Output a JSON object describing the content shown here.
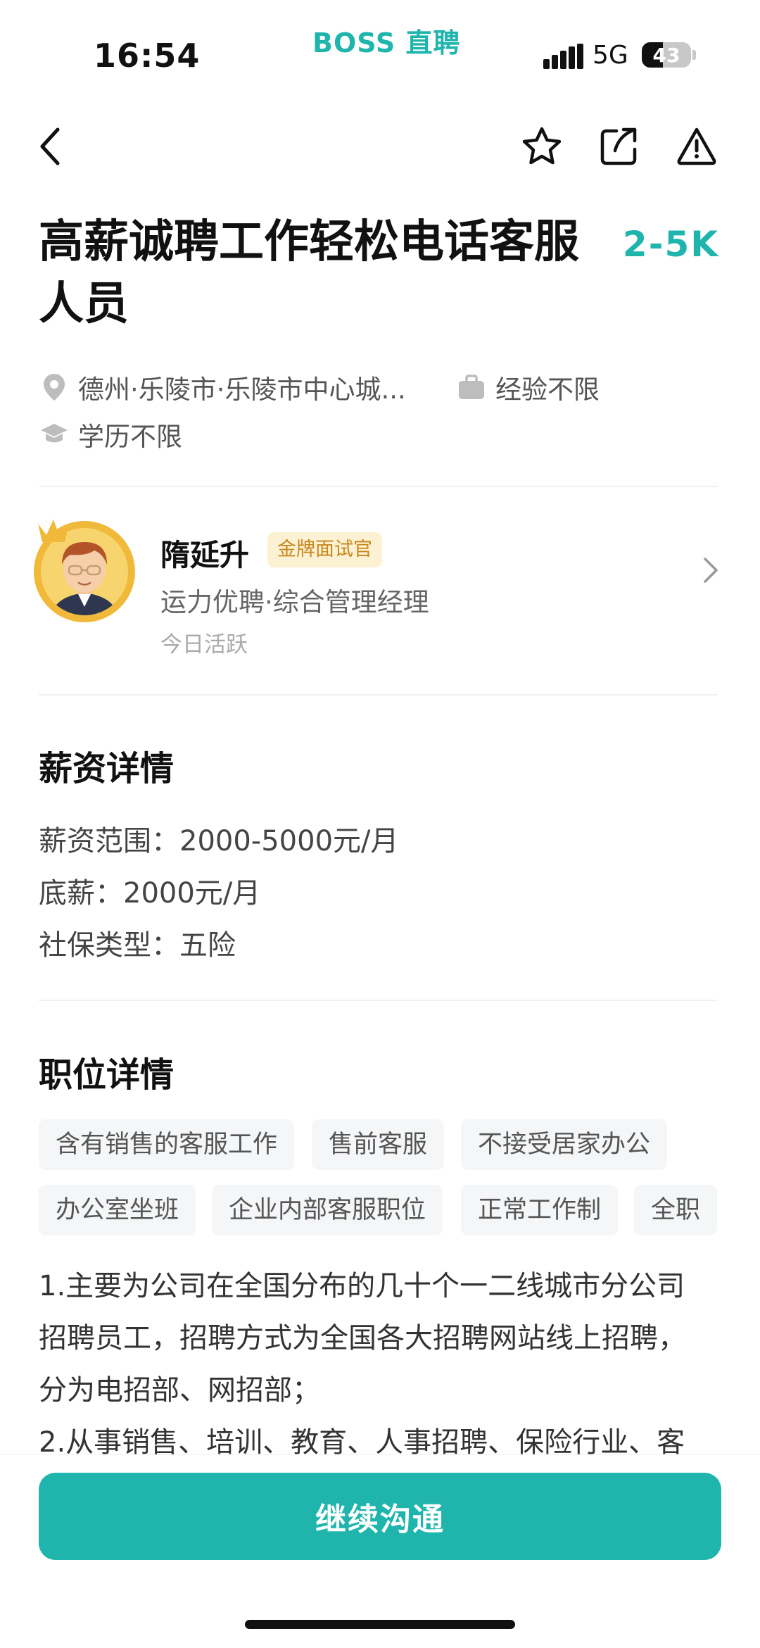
{
  "status_bar": {
    "time": "16:54",
    "brand": "BOSS 直聘",
    "network": "5G",
    "battery": "43",
    "battery_level": 0.43
  },
  "nav": {
    "back_icon": "chevron-left-icon",
    "favorite_icon": "star-icon",
    "share_icon": "share-icon",
    "report_icon": "warning-icon"
  },
  "job": {
    "title": "高薪诚聘工作轻松电话客服人员",
    "salary": "2-5K",
    "location": "德州·乐陵市·乐陵市中心城...",
    "experience": "经验不限",
    "education": "学历不限"
  },
  "recruiter": {
    "name": "隋延升",
    "badge": "金牌面试官",
    "company_title": "运力优聘·综合管理经理",
    "active": "今日活跃"
  },
  "salary_details": {
    "heading": "薪资详情",
    "range": "薪资范围：2000-5000元/月",
    "base": "底薪：2000元/月",
    "insurance": "社保类型：五险"
  },
  "job_details": {
    "heading": "职位详情",
    "tags": [
      "含有销售的客服工作",
      "售前客服",
      "不接受居家办公",
      "办公室坐班",
      "企业内部客服职位",
      "正常工作制",
      "全职"
    ],
    "description_lines": [
      "1.主要为公司在全国分布的几十个一二线城市分公司",
      "招聘员工，招聘方式为全国各大招聘网站线上招聘，",
      "分为电招部、网招部；",
      "2.从事销售、培训、教育、人事招聘、保险行业、客"
    ]
  },
  "cta": {
    "label": "继续沟通"
  },
  "colors": {
    "accent": "#1fb5ad",
    "badge_bg": "#fdf1d4",
    "badge_text": "#c7871a"
  }
}
